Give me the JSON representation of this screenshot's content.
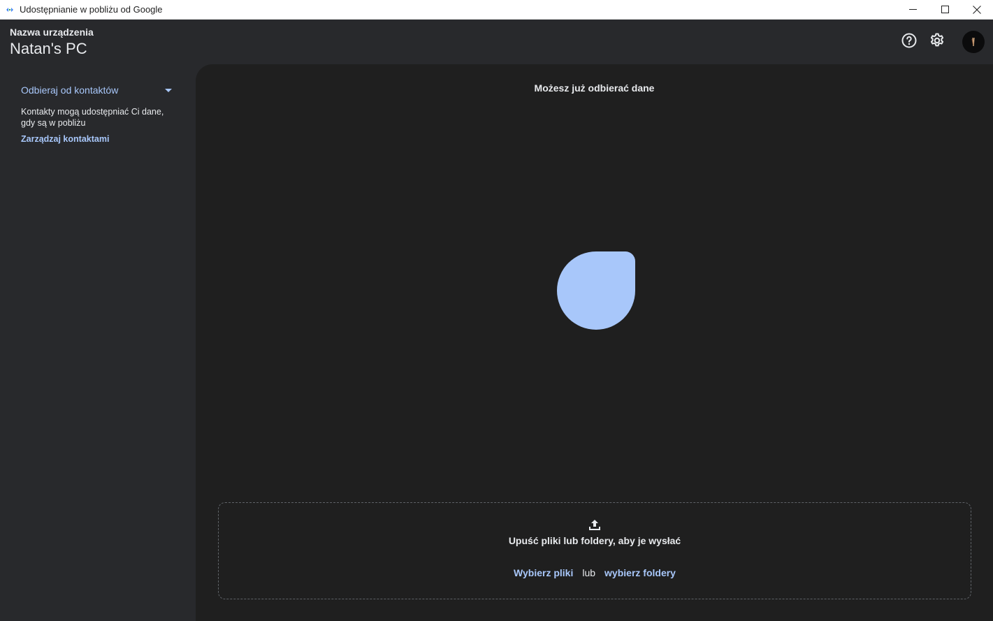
{
  "window": {
    "title": "Udostępnianie w pobliżu od Google"
  },
  "header": {
    "device_label": "Nazwa urządzenia",
    "device_name": "Natan's PC"
  },
  "sidebar": {
    "receive_mode": "Odbieraj od kontaktów",
    "receive_description": "Kontakty mogą udostępniać Ci dane, gdy są w pobliżu",
    "manage_contacts": "Zarządzaj kontaktami"
  },
  "main": {
    "status": "Możesz już odbierać dane",
    "dropzone": {
      "text": "Upuść pliki lub foldery, aby je wysłać",
      "select_files": "Wybierz pliki",
      "or": "lub",
      "select_folders": "wybierz foldery"
    }
  },
  "colors": {
    "accent": "#a8c7fa",
    "background": "#28292c",
    "panel": "#1f1f1f"
  },
  "icons": [
    "app-icon",
    "minimize-icon",
    "maximize-icon",
    "close-icon",
    "help-icon",
    "gear-icon",
    "chevron-down-icon",
    "upload-icon"
  ]
}
